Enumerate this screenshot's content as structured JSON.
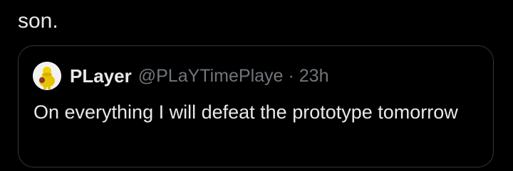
{
  "post": {
    "text_tail": "son."
  },
  "quote": {
    "avatar_icon": "yellow-figure-avatar-icon",
    "display_name": "PLayer",
    "handle": "@PLaYTimePlaye",
    "separator": "·",
    "timestamp": "23h",
    "text": "On everything I will defeat the prototype tomorrow"
  },
  "colors": {
    "background": "#000000",
    "primary_text": "#e7e9ea",
    "secondary_text": "#71767b",
    "card_border": "#333639"
  }
}
